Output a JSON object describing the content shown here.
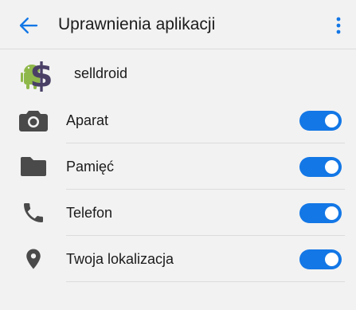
{
  "header": {
    "title": "Uprawnienia aplikacji",
    "back_icon": "arrow-back-icon",
    "more_icon": "more-vertical-icon"
  },
  "app": {
    "name": "selldroid",
    "icon": "selldroid-app-icon"
  },
  "permissions": [
    {
      "label": "Aparat",
      "icon": "camera-icon",
      "enabled": true
    },
    {
      "label": "Pamięć",
      "icon": "folder-icon",
      "enabled": true
    },
    {
      "label": "Telefon",
      "icon": "phone-icon",
      "enabled": true
    },
    {
      "label": "Twoja lokalizacja",
      "icon": "location-pin-icon",
      "enabled": true
    }
  ],
  "colors": {
    "accent": "#1377e6",
    "icon_gray": "#4a4a4a",
    "background": "#f2f2f2",
    "text": "#1b1b1b"
  }
}
